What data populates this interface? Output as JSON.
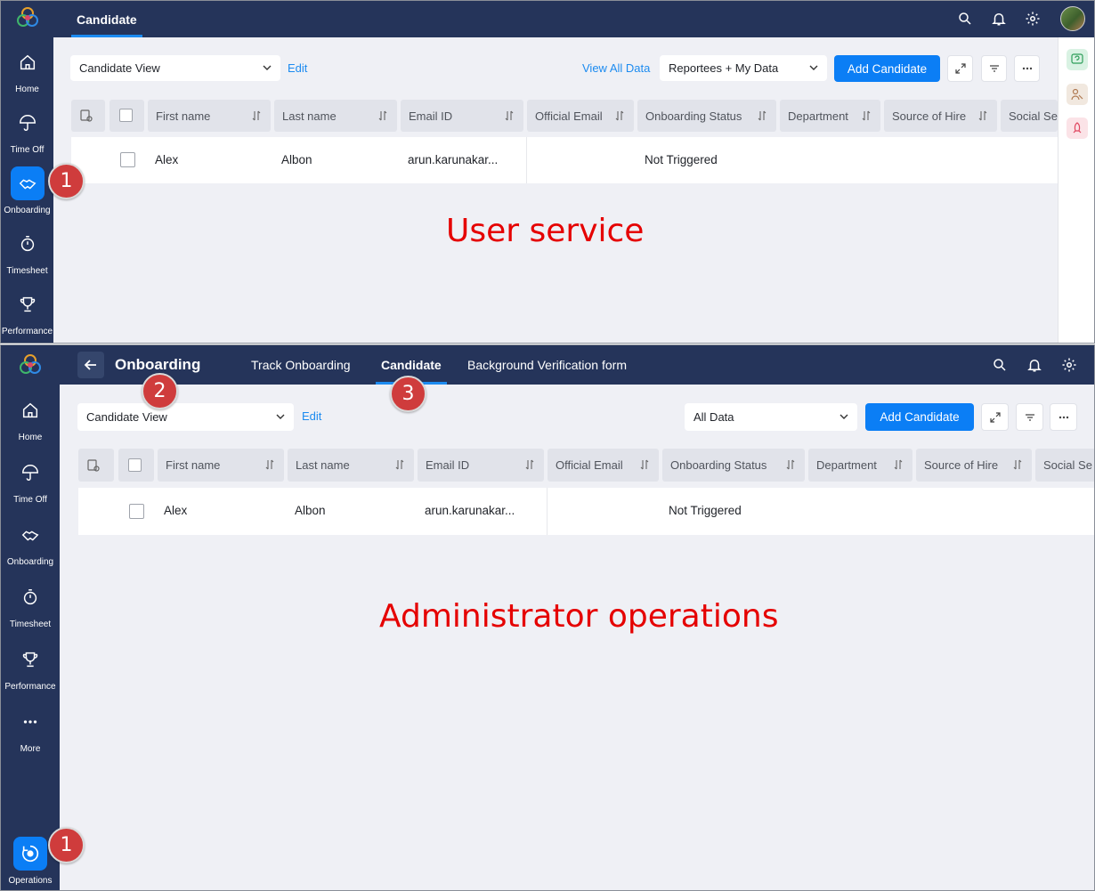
{
  "top_panel": {
    "tab_candidate": "Candidate",
    "sidebar": [
      {
        "label": "Home",
        "icon": "home-icon"
      },
      {
        "label": "Time Off",
        "icon": "umbrella-icon"
      },
      {
        "label": "Onboarding",
        "icon": "handshake-icon"
      },
      {
        "label": "Timesheet",
        "icon": "stopwatch-icon"
      },
      {
        "label": "Performance",
        "icon": "trophy-icon"
      }
    ],
    "view_select": "Candidate View",
    "edit_link": "Edit",
    "view_all_link": "View All Data",
    "filter_select": "Reportees + My Data",
    "add_button": "Add Candidate",
    "columns": [
      "First name",
      "Last name",
      "Email ID",
      "Official Email",
      "Onboarding Status",
      "Department",
      "Source of Hire",
      "Social Se"
    ],
    "row": {
      "first_name": "Alex",
      "last_name": "Albon",
      "email": "arun.karunakar...",
      "status": "Not Triggered"
    },
    "caption": "User service",
    "marker": "1"
  },
  "bottom_panel": {
    "module_title": "Onboarding",
    "tabs": [
      "Track Onboarding",
      "Candidate",
      "Background Verification form"
    ],
    "sidebar": [
      {
        "label": "Home",
        "icon": "home-icon"
      },
      {
        "label": "Time Off",
        "icon": "umbrella-icon"
      },
      {
        "label": "Onboarding",
        "icon": "handshake-icon"
      },
      {
        "label": "Timesheet",
        "icon": "stopwatch-icon"
      },
      {
        "label": "Performance",
        "icon": "trophy-icon"
      },
      {
        "label": "More",
        "icon": "more-icon"
      },
      {
        "label": "Operations",
        "icon": "operations-icon"
      }
    ],
    "view_select": "Candidate View",
    "edit_link": "Edit",
    "filter_select": "All Data",
    "add_button": "Add Candidate",
    "columns": [
      "First name",
      "Last name",
      "Email ID",
      "Official Email",
      "Onboarding Status",
      "Department",
      "Source of Hire",
      "Social Se"
    ],
    "row": {
      "first_name": "Alex",
      "last_name": "Albon",
      "email": "arun.karunakar...",
      "status": "Not Triggered"
    },
    "caption": "Administrator operations",
    "markers": [
      "1",
      "2",
      "3"
    ]
  },
  "colors": {
    "sidebar": "#25345a",
    "accent": "#0b7ef5",
    "background": "#eff0f5",
    "annotation": "#e50000"
  }
}
